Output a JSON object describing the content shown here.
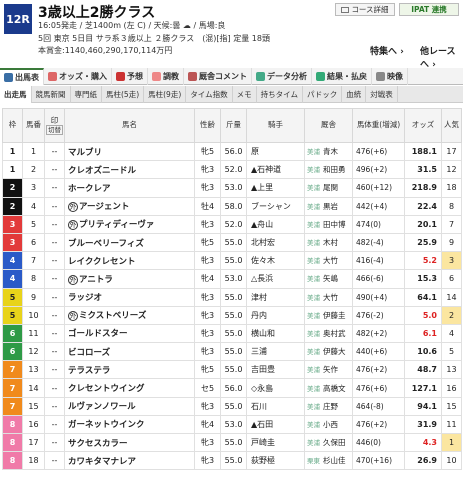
{
  "race": {
    "number": "12R",
    "title": "3歳以上2勝クラス",
    "info1": "16:05発走 / 芝1400m (左 C) / 天候:曇 ☁ / 馬場:良",
    "info2": "5回 東京 5日目 サラ系３歳以上 ２勝クラス　(混)[指] 定量 18頭",
    "info3": "本賞金:1140,460,290,170,114万円",
    "course_button": "コース詳細",
    "ipat_button": "IPAT 連携",
    "tokubetsu_link": "特集へ ›",
    "next_link": "他レースへ ›"
  },
  "tabs": [
    {
      "label": "出馬表",
      "icon": "table-icon",
      "color": "#3a6ea5",
      "active": true
    },
    {
      "label": "オッズ・購入",
      "icon": "odds-icon",
      "color": "#d66",
      "active": false
    },
    {
      "label": "予想",
      "icon": "target-icon",
      "color": "#c33",
      "active": false
    },
    {
      "label": "調教",
      "icon": "training-icon",
      "color": "#e88",
      "active": false
    },
    {
      "label": "厩舎コメント",
      "icon": "comment-icon",
      "color": "#b55",
      "active": false
    },
    {
      "label": "データ分析",
      "icon": "data-icon",
      "color": "#4a8",
      "active": false
    },
    {
      "label": "結果・払戻",
      "icon": "result-icon",
      "color": "#3a7",
      "active": false
    },
    {
      "label": "映像",
      "icon": "video-icon",
      "color": "#888",
      "active": false
    }
  ],
  "subtabs": [
    "出走馬",
    "競馬新聞",
    "専門紙",
    "馬柱(5走)",
    "馬柱(9走)",
    "タイム指数",
    "メモ",
    "持ちタイム",
    "パドック",
    "血統",
    "対戦表"
  ],
  "headers": {
    "waku": "枠",
    "umaban": "馬番",
    "mark": "印",
    "kirikae": "切替",
    "name": "馬名",
    "sex": "性齢",
    "kinryo": "斤量",
    "jockey": "騎手",
    "trainer": "厩舎",
    "weight": "馬体重(増減)",
    "odds": "オッズ",
    "ninki": "人気"
  },
  "horses": [
    {
      "waku": "1",
      "umaban": "1",
      "mark": "--",
      "name": "マルブリ",
      "circ": "",
      "sex": "牝5",
      "kinryo": "56.0",
      "jockey": "原",
      "tr_region": "美浦",
      "trainer": "青木",
      "weight": "476(+6)",
      "odds": "188.1",
      "ninki": "17",
      "odds_red": false
    },
    {
      "waku": "1",
      "umaban": "2",
      "mark": "--",
      "name": "クレオズニードル",
      "circ": "",
      "sex": "牝3",
      "kinryo": "52.0",
      "jockey": "▲石神道",
      "tr_region": "美浦",
      "trainer": "和田勇",
      "weight": "496(+2)",
      "odds": "31.5",
      "ninki": "12",
      "odds_red": false
    },
    {
      "waku": "2",
      "umaban": "3",
      "mark": "--",
      "name": "ホークレア",
      "circ": "",
      "sex": "牝3",
      "kinryo": "53.0",
      "jockey": "▲上里",
      "tr_region": "美浦",
      "trainer": "尾関",
      "weight": "460(+12)",
      "odds": "218.9",
      "ninki": "18",
      "odds_red": false
    },
    {
      "waku": "2",
      "umaban": "4",
      "mark": "--",
      "name": "アージェント",
      "circ": "外",
      "sex": "牡4",
      "kinryo": "58.0",
      "jockey": "ブーシャン",
      "tr_region": "美浦",
      "trainer": "黒岩",
      "weight": "442(+4)",
      "odds": "22.4",
      "ninki": "8",
      "odds_red": false
    },
    {
      "waku": "3",
      "umaban": "5",
      "mark": "--",
      "name": "プリティディーヴァ",
      "circ": "外",
      "sex": "牝3",
      "kinryo": "52.0",
      "jockey": "▲舟山",
      "tr_region": "美浦",
      "trainer": "田中博",
      "weight": "474(0)",
      "odds": "20.1",
      "ninki": "7",
      "odds_red": false
    },
    {
      "waku": "3",
      "umaban": "6",
      "mark": "--",
      "name": "ブルーベリーフィズ",
      "circ": "",
      "sex": "牝5",
      "kinryo": "55.0",
      "jockey": "北村宏",
      "tr_region": "美浦",
      "trainer": "木村",
      "weight": "482(-4)",
      "odds": "25.9",
      "ninki": "9",
      "odds_red": false
    },
    {
      "waku": "4",
      "umaban": "7",
      "mark": "--",
      "name": "レイククレセント",
      "circ": "",
      "sex": "牝3",
      "kinryo": "55.0",
      "jockey": "佐々木",
      "tr_region": "美浦",
      "trainer": "大竹",
      "weight": "416(-4)",
      "odds": "5.2",
      "ninki": "3",
      "odds_red": true
    },
    {
      "waku": "4",
      "umaban": "8",
      "mark": "--",
      "name": "アニトラ",
      "circ": "外",
      "sex": "牝4",
      "kinryo": "53.0",
      "jockey": "△長浜",
      "tr_region": "美浦",
      "trainer": "矢嶋",
      "weight": "466(-6)",
      "odds": "15.3",
      "ninki": "6",
      "odds_red": false
    },
    {
      "waku": "5",
      "umaban": "9",
      "mark": "--",
      "name": "ラッジオ",
      "circ": "",
      "sex": "牝3",
      "kinryo": "55.0",
      "jockey": "津村",
      "tr_region": "美浦",
      "trainer": "大竹",
      "weight": "490(+4)",
      "odds": "64.1",
      "ninki": "14",
      "odds_red": false
    },
    {
      "waku": "5",
      "umaban": "10",
      "mark": "--",
      "name": "ミクストベリーズ",
      "circ": "外",
      "sex": "牝3",
      "kinryo": "55.0",
      "jockey": "丹内",
      "tr_region": "美浦",
      "trainer": "伊藤圭",
      "weight": "476(-2)",
      "odds": "5.0",
      "ninki": "2",
      "odds_red": true
    },
    {
      "waku": "6",
      "umaban": "11",
      "mark": "--",
      "name": "ゴールドスター",
      "circ": "",
      "sex": "牝3",
      "kinryo": "55.0",
      "jockey": "横山和",
      "tr_region": "美浦",
      "trainer": "奥村武",
      "weight": "482(+2)",
      "odds": "6.1",
      "ninki": "4",
      "odds_red": true
    },
    {
      "waku": "6",
      "umaban": "12",
      "mark": "--",
      "name": "ビコローズ",
      "circ": "",
      "sex": "牝3",
      "kinryo": "55.0",
      "jockey": "三浦",
      "tr_region": "美浦",
      "trainer": "伊藤大",
      "weight": "440(+6)",
      "odds": "10.6",
      "ninki": "5",
      "odds_red": false
    },
    {
      "waku": "7",
      "umaban": "13",
      "mark": "--",
      "name": "テラステラ",
      "circ": "",
      "sex": "牝5",
      "kinryo": "55.0",
      "jockey": "吉田豊",
      "tr_region": "美浦",
      "trainer": "矢作",
      "weight": "476(+2)",
      "odds": "48.7",
      "ninki": "13",
      "odds_red": false
    },
    {
      "waku": "7",
      "umaban": "14",
      "mark": "--",
      "name": "クレセントウイング",
      "circ": "",
      "sex": "セ5",
      "kinryo": "56.0",
      "jockey": "◇永島",
      "tr_region": "美浦",
      "trainer": "高橋文",
      "weight": "476(+6)",
      "odds": "127.1",
      "ninki": "16",
      "odds_red": false
    },
    {
      "waku": "7",
      "umaban": "15",
      "mark": "--",
      "name": "ルヴァンノワール",
      "circ": "",
      "sex": "牝3",
      "kinryo": "55.0",
      "jockey": "石川",
      "tr_region": "美浦",
      "trainer": "庄野",
      "weight": "464(-8)",
      "odds": "94.1",
      "ninki": "15",
      "odds_red": false
    },
    {
      "waku": "8",
      "umaban": "16",
      "mark": "--",
      "name": "ガーネットウインク",
      "circ": "",
      "sex": "牝4",
      "kinryo": "53.0",
      "jockey": "▲石田",
      "tr_region": "美浦",
      "trainer": "小西",
      "weight": "476(+2)",
      "odds": "31.9",
      "ninki": "11",
      "odds_red": false
    },
    {
      "waku": "8",
      "umaban": "17",
      "mark": "--",
      "name": "サクセスカラー",
      "circ": "",
      "sex": "牝3",
      "kinryo": "55.0",
      "jockey": "戸崎圭",
      "tr_region": "美浦",
      "trainer": "久保田",
      "weight": "446(0)",
      "odds": "4.3",
      "ninki": "1",
      "odds_red": true
    },
    {
      "waku": "8",
      "umaban": "18",
      "mark": "--",
      "name": "カワキタマナレア",
      "circ": "",
      "sex": "牝3",
      "kinryo": "55.0",
      "jockey": "荻野極",
      "tr_region": "栗東",
      "trainer": "杉山佳",
      "weight": "470(+16)",
      "odds": "26.9",
      "ninki": "10",
      "odds_red": false
    }
  ],
  "colors": {
    "waku": {
      "1": "#ffffff",
      "2": "#111111",
      "3": "#e23a3a",
      "4": "#2a5ac8",
      "5": "#e8d31a",
      "6": "#2e9a46",
      "7": "#f08a1c",
      "8": "#f07aa8"
    },
    "waku_text": {
      "1": "#222222",
      "5": "#222222"
    }
  }
}
